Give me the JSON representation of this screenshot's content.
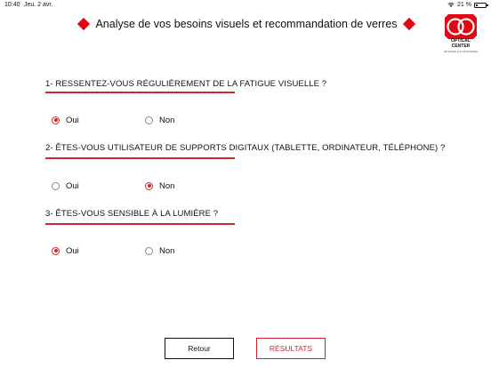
{
  "status_bar": {
    "time": "10:40",
    "date": "Jeu. 2 avr.",
    "battery": "21 %",
    "battery_level": 0.21
  },
  "header": {
    "title": "Analyse de vos besoins visuels et recommandation de verres",
    "accent_color": "#e30613"
  },
  "logo": {
    "line1": "OPTICAL",
    "line2": "CENTER",
    "tagline": "OPTICIEN & ACOUSTICIEN"
  },
  "questions": [
    {
      "label": "1- RESSENTEZ-VOUS RÉGULIÈREMENT DE LA FATIGUE VISUELLE ?",
      "options": [
        "Oui",
        "Non"
      ],
      "selected": "Oui"
    },
    {
      "label": "2- ÊTES-VOUS UTILISATEUR DE SUPPORTS DIGITAUX (TABLETTE, ORDINATEUR, TÉLÉPHONE) ?",
      "options": [
        "Oui",
        "Non"
      ],
      "selected": "Non"
    },
    {
      "label": "3- ÊTES-VOUS SENSIBLE À LA LUMIÈRE ?",
      "options": [
        "Oui",
        "Non"
      ],
      "selected": "Oui"
    }
  ],
  "buttons": {
    "back": "Retour",
    "results": "RÉSULTATS"
  }
}
